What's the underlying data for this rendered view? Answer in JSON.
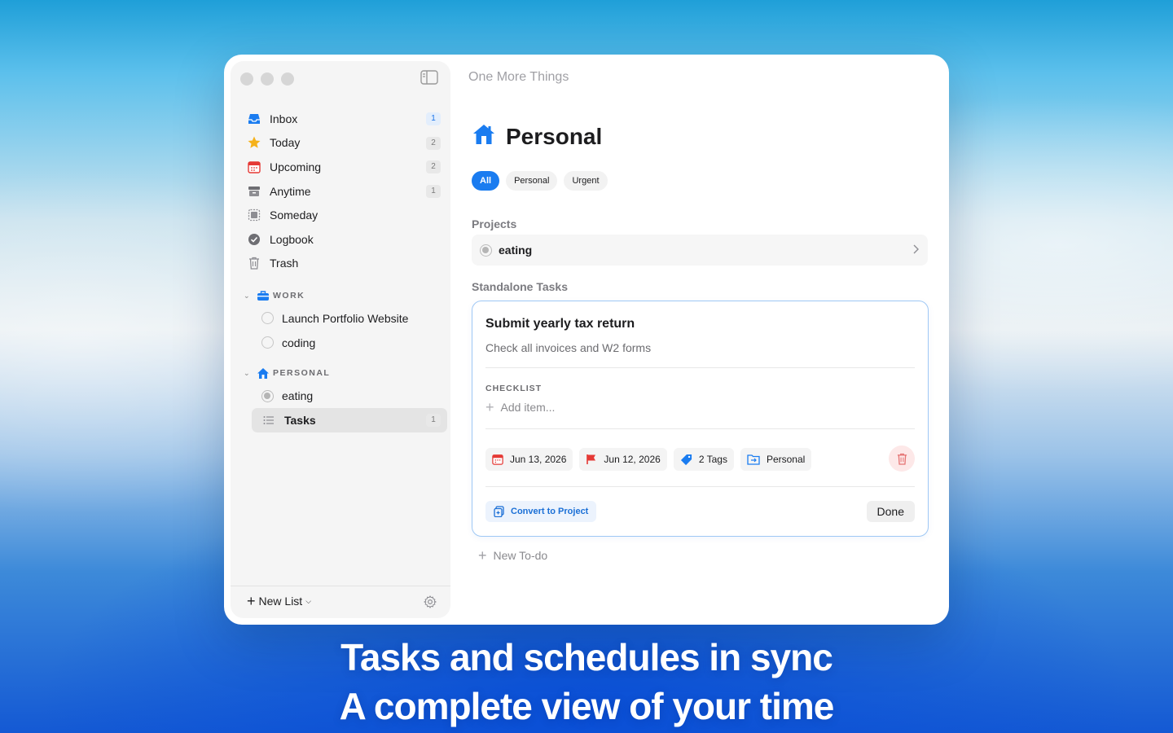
{
  "window": {
    "app_title": "One More Things"
  },
  "sidebar": {
    "smart_lists": [
      {
        "label": "Inbox",
        "count": "1",
        "icon": "inbox-icon"
      },
      {
        "label": "Today",
        "count": "2",
        "icon": "star-icon"
      },
      {
        "label": "Upcoming",
        "count": "2",
        "icon": "calendar-icon"
      },
      {
        "label": "Anytime",
        "count": "1",
        "icon": "archive-icon"
      },
      {
        "label": "Someday",
        "count": "",
        "icon": "box-icon"
      },
      {
        "label": "Logbook",
        "count": "",
        "icon": "checkmark-circle-icon"
      },
      {
        "label": "Trash",
        "count": "",
        "icon": "trash-icon"
      }
    ],
    "areas": [
      {
        "name": "WORK",
        "icon": "briefcase-icon",
        "items": [
          "Launch Portfolio Website",
          "coding"
        ]
      },
      {
        "name": "PERSONAL",
        "icon": "house-icon",
        "items": [
          "eating",
          "Tasks"
        ],
        "tasks_count": "1"
      }
    ],
    "footer": {
      "new_list_label": "New List"
    }
  },
  "main": {
    "title": "Personal",
    "title_icon": "house-icon",
    "filters": [
      "All",
      "Personal",
      "Urgent"
    ],
    "active_filter": "All",
    "projects_label": "Projects",
    "projects": [
      {
        "name": "eating"
      }
    ],
    "standalone_label": "Standalone Tasks",
    "task": {
      "title": "Submit yearly tax return",
      "notes": "Check all invoices and W2 forms",
      "checklist_label": "CHECKLIST",
      "add_item_placeholder": "Add item...",
      "when_date": "Jun 13, 2026",
      "deadline": "Jun 12, 2026",
      "tags": "2 Tags",
      "list": "Personal",
      "convert_label": "Convert to Project",
      "done_label": "Done"
    },
    "new_todo_label": "New To-do"
  },
  "headline": {
    "line1": "Tasks and schedules in sync",
    "line2": "A complete view of your time"
  },
  "colors": {
    "accent": "#1a7cf0",
    "deadline_flag": "#e53935",
    "trash": "#e57373"
  }
}
